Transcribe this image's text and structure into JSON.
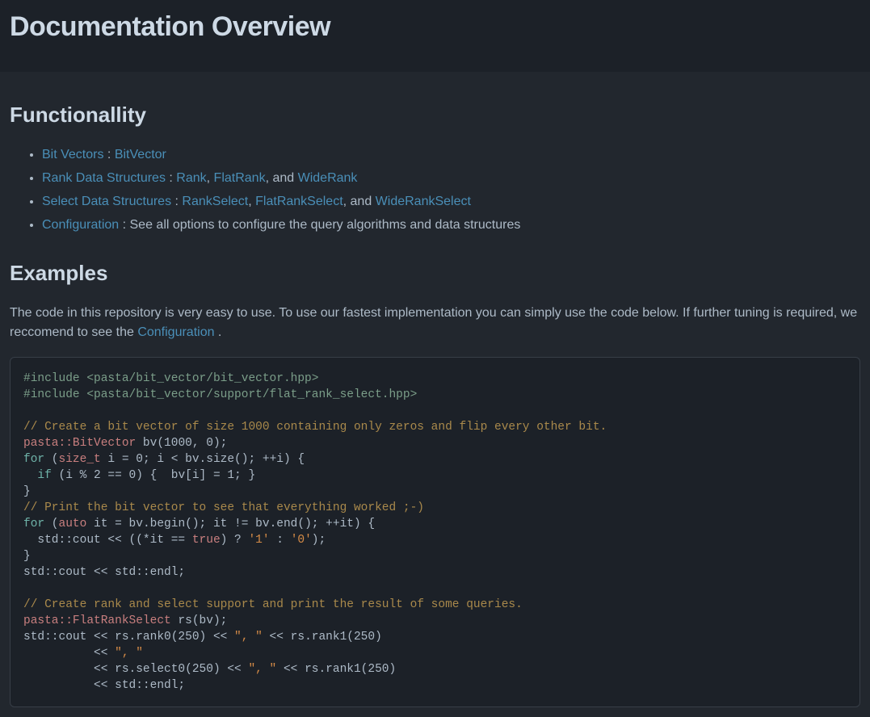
{
  "header": {
    "title": "Documentation Overview"
  },
  "sections": {
    "functionality": {
      "heading": "Functionallity",
      "items": {
        "bit_vectors": {
          "label": "Bit Vectors",
          "sep": " : ",
          "class1": "BitVector"
        },
        "rank": {
          "label": "Rank Data Structures",
          "sep": " : ",
          "class1": "Rank",
          "comma": ", ",
          "class2": "FlatRank",
          "and": ", and ",
          "class3": "WideRank"
        },
        "select": {
          "label": "Select Data Structures",
          "sep": " : ",
          "class1": "RankSelect",
          "comma": ", ",
          "class2": "FlatRankSelect",
          "and": ", and ",
          "class3": "WideRankSelect"
        },
        "config": {
          "label": "Configuration",
          "tail": " : See all options to configure the query algorithms and data structures"
        }
      }
    },
    "examples": {
      "heading": "Examples",
      "intro_pre": "The code in this repository is very easy to use. To use our fastest implementation you can simply use the code below. If further tuning is required, we reccomend to see the ",
      "intro_link": "Configuration",
      "intro_post": " ."
    }
  },
  "code": {
    "inc1": "#include <pasta/bit_vector/bit_vector.hpp>",
    "inc2": "#include <pasta/bit_vector/support/flat_rank_select.hpp>",
    "blank": "",
    "cmt1": "// Create a bit vector of size 1000 containing only zeros and flip every other bit.",
    "type_bv": "pasta::BitVector",
    "l_bv_tail": " bv(1000, 0);",
    "kw_for1": "for",
    "l_for1_mid": " (",
    "type_size_t": "size_t",
    "l_for1_tail": " i = 0; i < bv.size(); ++i) {",
    "indent_if": "  ",
    "kw_if": "if",
    "l_if_tail": " (i % 2 == 0) {  bv[i] = 1; }",
    "l_close1": "}",
    "cmt2": "// Print the bit vector to see that everything worked ;-)",
    "kw_for2": "for",
    "l_for2_mid": " (",
    "kw_auto": "auto",
    "l_for2_tail": " it = bv.begin(); it != bv.end(); ++it) {",
    "l_cout1_pre": "  std::cout << ((*it == ",
    "kw_true": "true",
    "l_cout1_mid1": ") ? ",
    "char1": "'1'",
    "l_cout1_mid2": " : ",
    "char0": "'0'",
    "l_cout1_tail": ");",
    "l_close2": "}",
    "l_endl1": "std::cout << std::endl;",
    "cmt3": "// Create rank and select support and print the result of some queries.",
    "type_frs": "pasta::FlatRankSelect",
    "l_rs_tail": " rs(bv);",
    "l_rank_pre": "std::cout << rs.rank0(250) << ",
    "str_comma_a": "\", \"",
    "l_rank_mid": " << rs.rank1(250)",
    "l_rank_indent": "          << ",
    "str_comma_b": "\", \"",
    "l_sel_pre": "          << rs.select0(250) << ",
    "str_comma_c": "\", \"",
    "l_sel_mid": " << rs.rank1(250)",
    "l_endl2": "          << std::endl;"
  }
}
